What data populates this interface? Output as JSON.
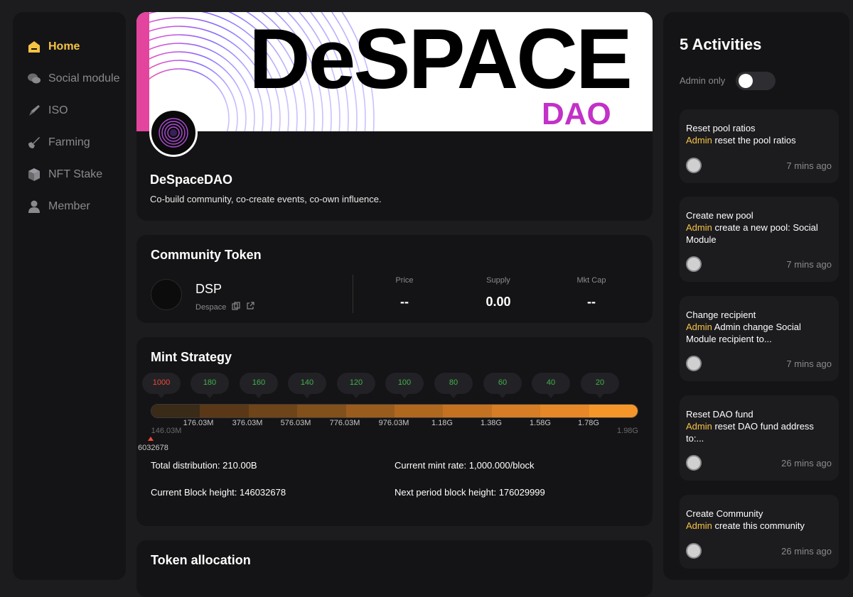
{
  "sidebar": {
    "items": [
      {
        "label": "Home",
        "icon": "home-icon"
      },
      {
        "label": "Social module",
        "icon": "chat-icon"
      },
      {
        "label": "ISO",
        "icon": "rocket-icon"
      },
      {
        "label": "Farming",
        "icon": "shovel-icon"
      },
      {
        "label": "NFT Stake",
        "icon": "cube-icon"
      },
      {
        "label": "Member",
        "icon": "user-icon"
      }
    ]
  },
  "banner": {
    "title": "DeSPACE",
    "subtitle": "DAO"
  },
  "profile": {
    "name": "DeSpaceDAO",
    "description": "Co-build community, co-create events, co-own influence."
  },
  "community_token": {
    "title": "Community Token",
    "symbol": "DSP",
    "name": "Despace",
    "price_label": "Price",
    "price_value": "--",
    "supply_label": "Supply",
    "supply_value": "0.00",
    "mktcap_label": "Mkt Cap",
    "mktcap_value": "--"
  },
  "mint_strategy": {
    "title": "Mint Strategy",
    "rates": [
      "1000",
      "180",
      "160",
      "140",
      "120",
      "100",
      "80",
      "60",
      "40",
      "20"
    ],
    "ticks": [
      "146.03M",
      "176.03M",
      "376.03M",
      "576.03M",
      "776.03M",
      "976.03M",
      "1.18G",
      "1.38G",
      "1.58G",
      "1.78G",
      "1.98G"
    ],
    "current_marker": "6032678",
    "total_distribution": "Total distribution: 210.00B",
    "current_mint_rate": "Current mint rate: 1,000.000/block",
    "current_block_height": "Current Block height: 146032678",
    "next_period_height": "Next period block height: 176029999",
    "segment_colors": [
      "#3a2a18",
      "#5a3817",
      "#6e4419",
      "#82501b",
      "#9a5c1d",
      "#b0681f",
      "#c47222",
      "#d67d25",
      "#e68828",
      "#f5962b"
    ]
  },
  "token_allocation": {
    "title": "Token allocation"
  },
  "activities": {
    "title": "5 Activities",
    "admin_only_label": "Admin only",
    "items": [
      {
        "title": "Reset pool ratios",
        "who": "Admin",
        "text": " reset the pool ratios",
        "time": "7 mins ago"
      },
      {
        "title": "Create new pool",
        "who": "Admin",
        "text": " create a new pool: Social Module",
        "time": "7 mins ago"
      },
      {
        "title": "Change recipient",
        "who": "Admin",
        "text": " Admin change Social Module recipient to...",
        "time": "7 mins ago"
      },
      {
        "title": "Reset DAO fund",
        "who": "Admin",
        "text": " reset DAO fund address to:...",
        "time": "26 mins ago"
      },
      {
        "title": "Create Community",
        "who": "Admin",
        "text": " create this community",
        "time": "26 mins ago"
      }
    ]
  },
  "colors": {
    "accent": "#f6c343",
    "background": "#1c1c1e",
    "card": "#141416"
  }
}
